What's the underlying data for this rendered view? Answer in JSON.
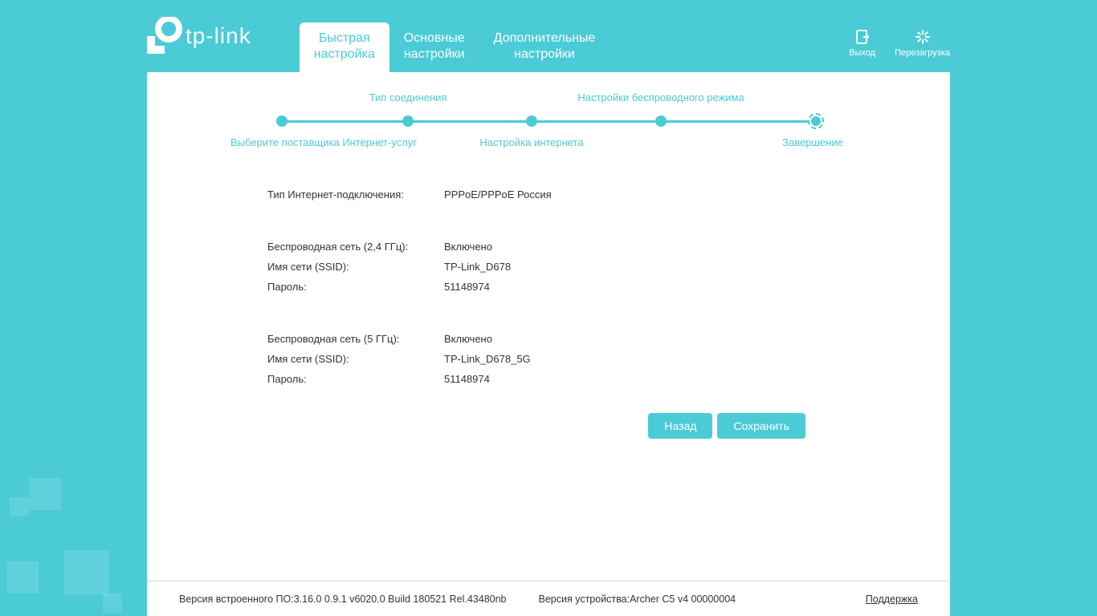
{
  "brand": "tp-link",
  "tabs": {
    "quick": "Быстрая\nнастройка",
    "basic": "Основные\nнастройки",
    "advanced": "Дополнительные\nнастройки"
  },
  "actions": {
    "logout": "Выход",
    "reboot": "Перезагрузка"
  },
  "wizard": {
    "step1": "Выберите поставщика Интернет-услуг",
    "step2": "Тип соединения",
    "step3": "Настройка интернета",
    "step4": "Настройки беспроводного режима",
    "step5": "Завершение"
  },
  "summary": {
    "conn_type_label": "Тип Интернет-подключения:",
    "conn_type_value": "PPPoE/PPPoE Россия",
    "w24": {
      "title_label": "Беспроводная сеть (2,4 ГГц):",
      "title_value": "Включено",
      "ssid_label": "Имя сети (SSID):",
      "ssid_value": "TP-Link_D678",
      "pwd_label": "Пароль:",
      "pwd_value": "51148974"
    },
    "w5": {
      "title_label": "Беспроводная сеть (5 ГГц):",
      "title_value": "Включено",
      "ssid_label": "Имя сети (SSID):",
      "ssid_value": "TP-Link_D678_5G",
      "pwd_label": "Пароль:",
      "pwd_value": "51148974"
    }
  },
  "buttons": {
    "back": "Назад",
    "save": "Сохранить"
  },
  "footer": {
    "fw": "Версия встроенного ПО:3.16.0 0.9.1 v6020.0 Build 180521 Rel.43480nb",
    "hw": "Версия устройства:Archer C5 v4 00000004",
    "support": "Поддержка"
  }
}
